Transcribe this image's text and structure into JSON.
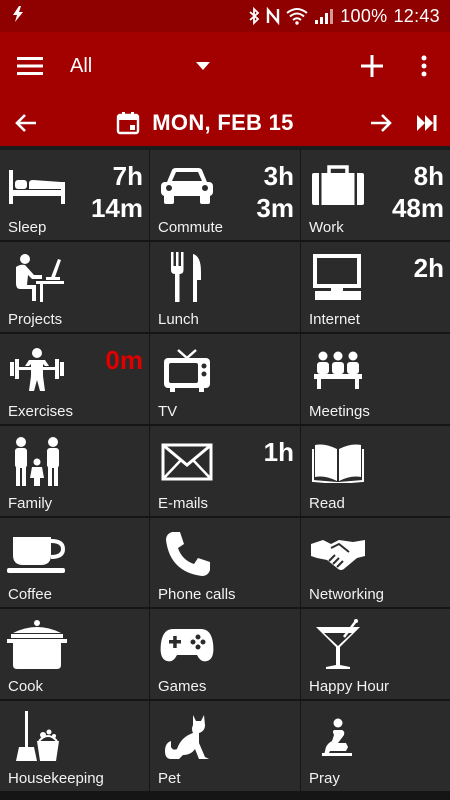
{
  "status": {
    "battery": "100%",
    "time": "12:43"
  },
  "toolbar": {
    "filter_label": "All"
  },
  "date": {
    "label": "MON, FEB 15"
  },
  "activities": [
    {
      "name": "Sleep",
      "duration": "7h\n14m",
      "icon": "bed-icon"
    },
    {
      "name": "Commute",
      "duration": "3h\n3m",
      "icon": "car-icon"
    },
    {
      "name": "Work",
      "duration": "8h\n48m",
      "icon": "briefcase-icon"
    },
    {
      "name": "Projects",
      "duration": "",
      "icon": "person-at-desk-icon"
    },
    {
      "name": "Lunch",
      "duration": "",
      "icon": "fork-knife-icon"
    },
    {
      "name": "Internet",
      "duration": "2h",
      "icon": "computer-icon"
    },
    {
      "name": "Exercises",
      "duration": "0m",
      "icon": "weightlifter-icon",
      "highlight": true
    },
    {
      "name": "TV",
      "duration": "",
      "icon": "tv-icon"
    },
    {
      "name": "Meetings",
      "duration": "",
      "icon": "meeting-icon"
    },
    {
      "name": "Family",
      "duration": "",
      "icon": "family-icon"
    },
    {
      "name": "E-mails",
      "duration": "1h",
      "icon": "envelope-icon"
    },
    {
      "name": "Read",
      "duration": "",
      "icon": "book-icon"
    },
    {
      "name": "Coffee",
      "duration": "",
      "icon": "coffee-cup-icon"
    },
    {
      "name": "Phone calls",
      "duration": "",
      "icon": "phone-icon"
    },
    {
      "name": "Networking",
      "duration": "",
      "icon": "handshake-icon"
    },
    {
      "name": "Cook",
      "duration": "",
      "icon": "cooking-pot-icon"
    },
    {
      "name": "Games",
      "duration": "",
      "icon": "gamepad-icon"
    },
    {
      "name": "Happy Hour",
      "duration": "",
      "icon": "cocktail-icon"
    },
    {
      "name": "Housekeeping",
      "duration": "",
      "icon": "broom-bucket-icon"
    },
    {
      "name": "Pet",
      "duration": "",
      "icon": "cat-icon"
    },
    {
      "name": "Pray",
      "duration": "",
      "icon": "praying-person-icon"
    }
  ],
  "colors": {
    "status_bar": "#8f0000",
    "toolbar": "#a30000",
    "cell": "#2b2b2b",
    "highlight": "#e00000"
  }
}
